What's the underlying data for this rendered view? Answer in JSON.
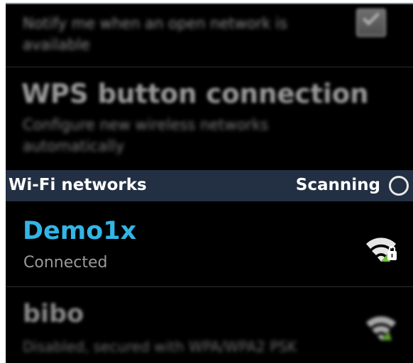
{
  "settings": {
    "notify_pref": {
      "summary": "Notify me when an open network is available",
      "checked": true
    },
    "wps": {
      "title": "WPS button connection",
      "summary": "Configure new wireless networks automatically"
    }
  },
  "header": {
    "title": "Wi-Fi networks",
    "scan_status": "Scanning"
  },
  "networks": [
    {
      "name": "Demo1x",
      "status": "Connected",
      "icon": "wifi-secured-icon",
      "name_color": "#33b5e5"
    },
    {
      "name": "bibo",
      "status": "Disabled, secured with WPA/WPA2 PSK",
      "icon": "wifi-secured-icon"
    }
  ],
  "colors": {
    "background": "#000000",
    "header_bg": "#233043",
    "accent": "#33b5e5"
  }
}
